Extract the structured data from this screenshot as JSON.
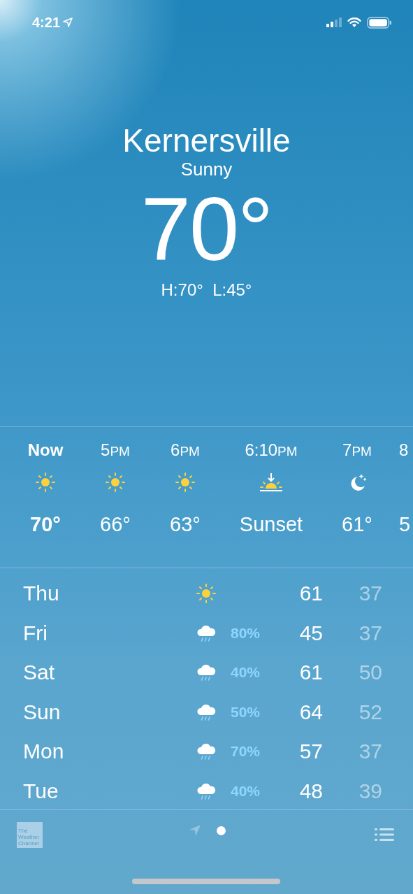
{
  "status_bar": {
    "time": "4:21",
    "location_active": true
  },
  "location": {
    "city": "Kernersville",
    "condition": "Sunny",
    "temperature": "70°",
    "high_low": "H:70°  L:45°"
  },
  "hourly": [
    {
      "hour": "Now",
      "current": true,
      "kind": "sun",
      "value": "70°"
    },
    {
      "hour": "5",
      "suffix": "PM",
      "current": false,
      "kind": "sun",
      "value": "66°"
    },
    {
      "hour": "6",
      "suffix": "PM",
      "current": false,
      "kind": "sun",
      "value": "63°"
    },
    {
      "hour": "6:10",
      "suffix": "PM",
      "current": false,
      "kind": "sunset",
      "value": "Sunset"
    },
    {
      "hour": "7",
      "suffix": "PM",
      "current": false,
      "kind": "moon",
      "value": "61°"
    },
    {
      "hour": "8",
      "current": false,
      "kind": "partial",
      "value": "5"
    }
  ],
  "daily": [
    {
      "day": "Thu",
      "kind": "sun",
      "high": "61",
      "low": "37"
    },
    {
      "day": "Fri",
      "kind": "rain",
      "precip": "80%",
      "high": "45",
      "low": "37"
    },
    {
      "day": "Sat",
      "kind": "rain",
      "precip": "40%",
      "high": "61",
      "low": "50"
    },
    {
      "day": "Sun",
      "kind": "rain",
      "precip": "50%",
      "high": "64",
      "low": "52"
    },
    {
      "day": "Mon",
      "kind": "rain",
      "precip": "70%",
      "high": "57",
      "low": "37"
    },
    {
      "day": "Tue",
      "kind": "rain",
      "precip": "40%",
      "high": "48",
      "low": "39"
    }
  ],
  "bottom_bar": {
    "logo_text": "The Weather Channel",
    "pages": [
      {
        "kind": "location",
        "selected": false
      },
      {
        "kind": "dot",
        "selected": true
      }
    ]
  }
}
